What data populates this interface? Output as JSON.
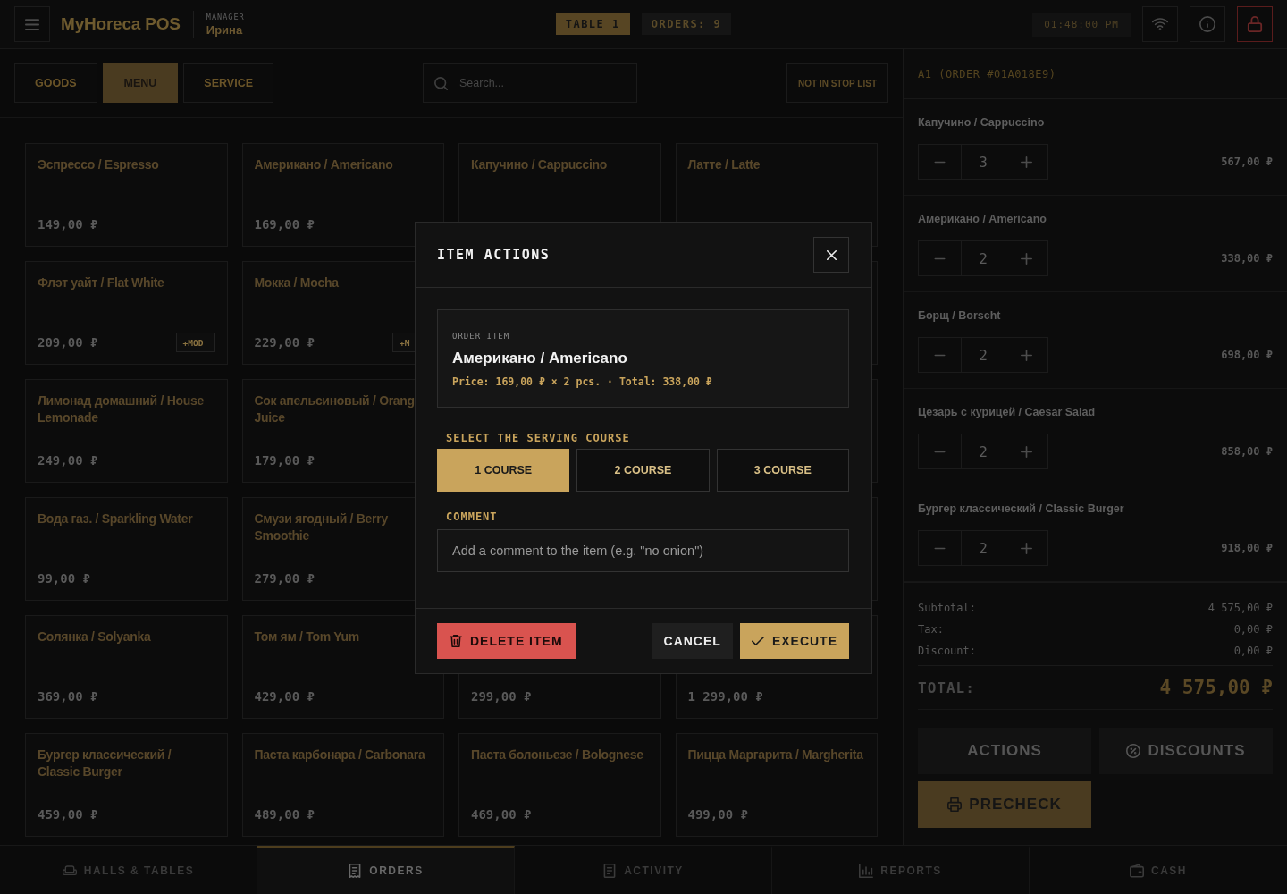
{
  "topbar": {
    "app_name": "MyHoreca POS",
    "user_role": "MANAGER",
    "user_name": "Ирина",
    "table_badge": "TABLE 1",
    "orders_badge": "ORDERS: 9",
    "clock": "01:48:00 PM"
  },
  "toolbar": {
    "tabs": [
      {
        "label": "GOODS",
        "selected": false
      },
      {
        "label": "MENU",
        "selected": true
      },
      {
        "label": "SERVICE",
        "selected": false
      }
    ],
    "search": {
      "placeholder": "Search..."
    },
    "filter_button": "NOT IN STOP LIST"
  },
  "product_rows": [
    [
      {
        "title": "Эспрессо / Espresso",
        "price": "149,00 ₽"
      },
      {
        "title": "Американо / Americano",
        "price": "169,00 ₽"
      },
      {
        "title": "Капучино / Cappuccino"
      },
      {
        "title": "Латте / Latte"
      }
    ],
    [
      {
        "title": "Флэт уайт / Flat White",
        "price": "209,00 ₽",
        "mod": "+MOD"
      },
      {
        "title": "Мокка / Mocha",
        "price": "229,00 ₽",
        "mod": "+M"
      }
    ],
    [
      {
        "title": "Лимонад домашний / House Lemonade",
        "price": "249,00 ₽"
      },
      {
        "title": "Сок апельсиновый / Orang Juice",
        "price": "179,00 ₽"
      }
    ],
    [
      {
        "title": "Вода газ. / Sparkling Water",
        "price": "99,00 ₽"
      },
      {
        "title": "Смузи ягодный / Berry Smoothie",
        "price": "279,00 ₽"
      }
    ],
    [
      {
        "title": "Солянка / Solyanka",
        "price": "369,00 ₽"
      },
      {
        "title": "Том ям / Tom Yum",
        "price": "429,00 ₽"
      },
      {
        "price": "299,00 ₽"
      },
      {
        "price": "1 299,00 ₽"
      }
    ],
    [
      {
        "title": "Бургер классический / Classic Burger",
        "price": "459,00 ₽"
      },
      {
        "title": "Паста карбонара / Carbonara",
        "price": "489,00 ₽"
      },
      {
        "title": "Паста болоньезе / Bolognese",
        "price": "469,00 ₽"
      },
      {
        "title": "Пицца Маргарита / Margherita",
        "price": "499,00 ₽"
      }
    ]
  ],
  "order_panel": {
    "title": "A1 (ORDER #01A018E9)",
    "items": [
      {
        "name": "Капучино / Cappuccino",
        "quantity": "3",
        "amount": "567,00 ₽"
      },
      {
        "name": "Американо / Americano",
        "quantity": "2",
        "amount": "338,00 ₽"
      },
      {
        "name": "Борщ / Borscht",
        "quantity": "2",
        "amount": "698,00 ₽"
      },
      {
        "name": "Цезарь с курицей / Caesar Salad",
        "quantity": "2",
        "amount": "858,00 ₽"
      },
      {
        "name": "Бургер классический / Classic Burger",
        "quantity": "2",
        "amount": "918,00 ₽"
      }
    ],
    "summary": [
      {
        "label": "Subtotal:",
        "value": "4 575,00 ₽"
      },
      {
        "label": "Tax:",
        "value": "0,00 ₽"
      },
      {
        "label": "Discount:",
        "value": "0,00 ₽"
      }
    ],
    "total": {
      "label": "TOTAL:",
      "value": "4 575,00 ₽"
    },
    "actions_button": "ACTIONS",
    "discounts_button": "DISCOUNTS",
    "precheck_button": "PRECHECK"
  },
  "bottom_nav": [
    {
      "label": "HALLS & TABLES",
      "selected": false
    },
    {
      "label": "ORDERS",
      "selected": true
    },
    {
      "label": "ACTIVITY",
      "selected": false
    },
    {
      "label": "REPORTS",
      "selected": false
    },
    {
      "label": "CASH",
      "selected": false
    }
  ],
  "modal": {
    "title": "ITEM ACTIONS",
    "item_caption": "ORDER ITEM",
    "item_name": "Американо / Americano",
    "item_details": "Price: 169,00 ₽ × 2 pcs. · Total: 338,00 ₽",
    "course_label": "SELECT THE SERVING COURSE",
    "courses": [
      {
        "label": "1 COURSE",
        "selected": true
      },
      {
        "label": "2 COURSE",
        "selected": false
      },
      {
        "label": "3 COURSE",
        "selected": false
      }
    ],
    "comment_label": "COMMENT",
    "comment": {
      "placeholder": "Add a comment to the item (e.g. \"no onion\")"
    },
    "delete_button": "DELETE ITEM",
    "cancel_button": "CANCEL",
    "execute_button": "EXECUTE"
  }
}
